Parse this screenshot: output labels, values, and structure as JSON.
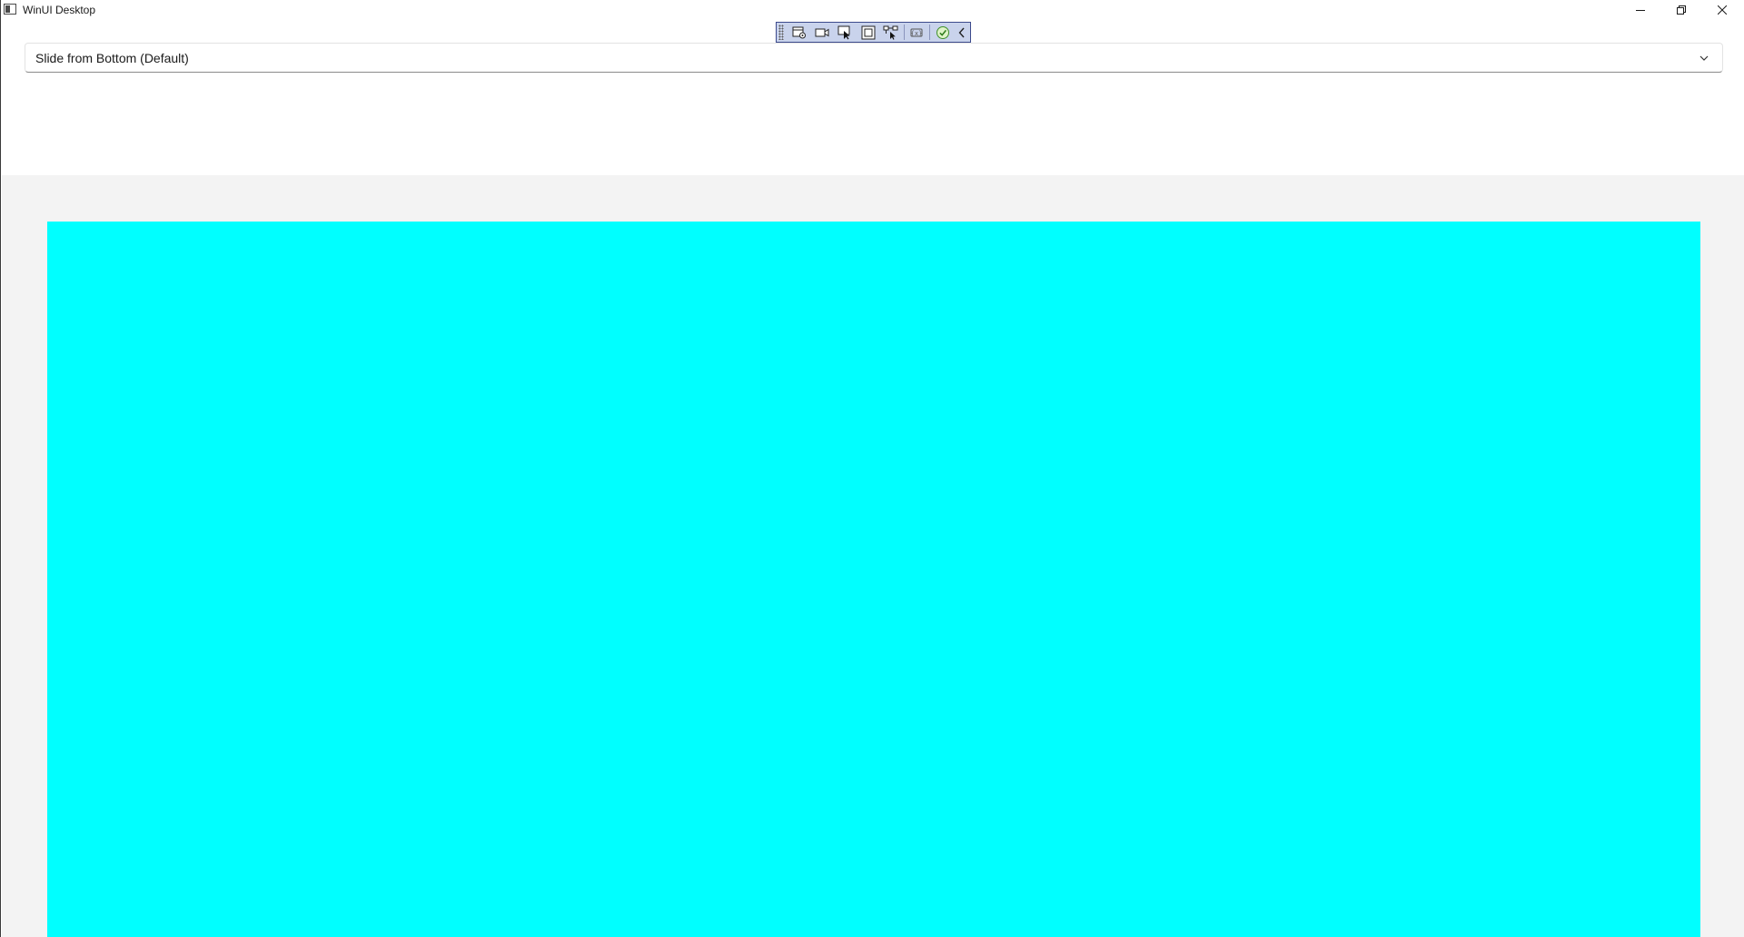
{
  "window": {
    "title": "WinUI Desktop",
    "icon": "app-window-icon"
  },
  "caption_buttons": {
    "minimize_icon": "minimize-icon",
    "restore_icon": "restore-icon",
    "close_icon": "close-icon"
  },
  "debug_toolbar": {
    "tools": [
      "live-visual-tree-icon",
      "record-icon",
      "select-element-icon",
      "display-layout-adorners-icon",
      "track-focus-icon",
      "binding-failures-icon",
      "hot-reload-status-icon",
      "collapse-icon"
    ]
  },
  "combo": {
    "selected": "Slide from Bottom (Default)",
    "chevron_icon": "chevron-down-icon"
  },
  "colors": {
    "panel": "#00ffff",
    "content_background": "#f3f3f3",
    "toolbar_background": "#c9d3ec",
    "toolbar_border": "#3c4a8c"
  }
}
